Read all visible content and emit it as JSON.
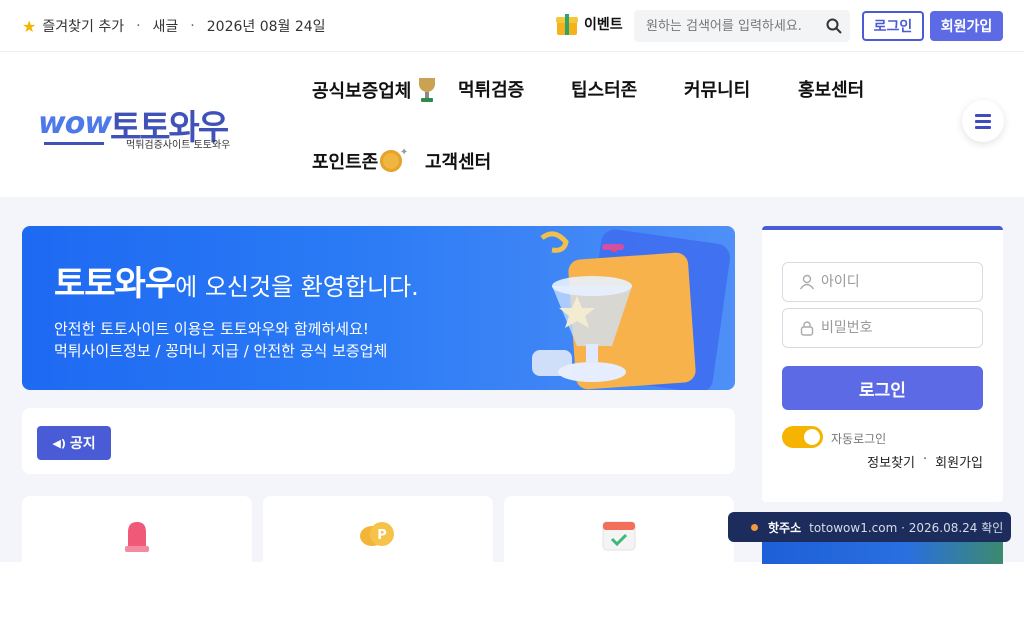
{
  "topbar": {
    "bookmark": "즐겨찾기 추가",
    "new_post": "새글",
    "date": "2026년 08월 24일",
    "event_label": "이벤트",
    "search_placeholder": "원하는 검색어를 입력하세요.",
    "login": "로그인",
    "join": "회원가입"
  },
  "logo": {
    "brand": "토토와우",
    "wow": "wow",
    "tagline": "먹튀검증사이트 토토와우"
  },
  "nav": {
    "items": [
      "공식보증업체",
      "먹튀검증",
      "팁스터존",
      "커뮤니티",
      "홍보센터",
      "포인트존",
      "고객센터"
    ]
  },
  "banner": {
    "headline_bold": "토토와우",
    "headline_rest": "에 오신것을 환영합니다.",
    "line1": "안전한 토토사이트 이용은 토토와우와 함께하세요!",
    "line2": "먹튀사이트정보 / 꽁머니 지급 / 안전한 공식 보증업체"
  },
  "notice": {
    "label": "공지"
  },
  "login_panel": {
    "id_placeholder": "아이디",
    "pw_placeholder": "비밀번호",
    "login_button": "로그인",
    "auto_login": "자동로그인",
    "find_info": "정보찾기",
    "join": "회원가입"
  },
  "toast": {
    "hot": "핫주소",
    "text": "totowow1.com · 2026.08.24 확인"
  },
  "colors": {
    "primary": "#4a5bd6",
    "button": "#5d6ae6",
    "banner": "#1e69f2",
    "accent": "#f6b400",
    "toast": "#1c2c5c"
  }
}
